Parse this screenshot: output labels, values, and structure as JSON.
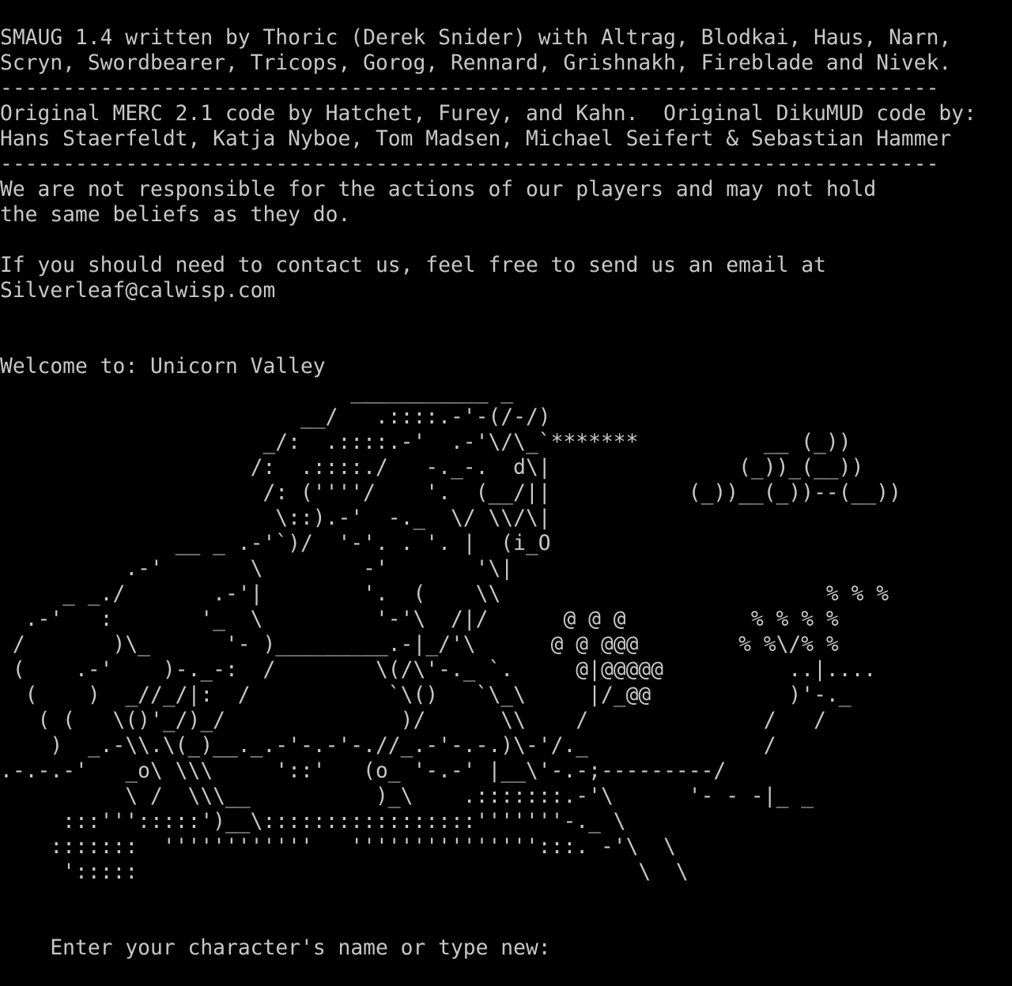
{
  "terminal": {
    "lines": [
      "SMAUG 1.4 written by Thoric (Derek Snider) with Altrag, Blodkai, Haus, Narn,",
      "Scryn, Swordbearer, Tricops, Gorog, Rennard, Grishnakh, Fireblade and Nivek.",
      "---------------------------------------------------------------------------",
      "Original MERC 2.1 code by Hatchet, Furey, and Kahn.  Original DikuMUD code by:",
      "Hans Staerfeldt, Katja Nyboe, Tom Madsen, Michael Seifert & Sebastian Hammer",
      "---------------------------------------------------------------------------",
      "We are not responsible for the actions of our players and may not hold",
      "the same beliefs as they do.",
      "",
      "If you should need to contact us, feel free to send us an email at",
      "Silverleaf@calwisp.com",
      "",
      "",
      "Welcome to: Unicorn Valley",
      "                            ___________ _",
      "                        __/   .::::.-'-(/-/)",
      "                     _/:  .::::.-'  .-'\\/\\_`*******          __ (_))",
      "                    /:  .::::./   -._-.  d\\|               (_))_(__))",
      "                     /: (''''/    '.  (__/||           (_))__(_))--(__))",
      "                      \\::).-'  -._  \\/ \\\\/\\|",
      "              __ _ .-'`)/  '-'. . '. |  (i_O",
      "          .-'       \\        -'       '\\|",
      "     _ _./       .-'|        '.  (    \\\\                          % % %",
      "  .-'   :       '_  \\         '-'\\  /|/      @ @ @          % % % %",
      " /       )\\_      '- )_________.-|_/'\\      @ @ @@@        % %\\/% %",
      " (    .-'    )-._-:  /        \\(/\\'-._ `.     @|@@@@@          ..|....",
      "  (    )  _//_/|:  /           `\\()   `\\_\\     |/_@@           )'-._",
      "   ( (   \\()'_/)_/              )/      \\\\    /              /   /",
      "    )  _.-\\\\.\\(_)__._.-'-.-'-.//_.-'-.-.)\\-'/._              /",
      ".-.-.-'   _o\\ \\\\\\     '::'   (o_ '-.-' |__\\'-.-;---------/",
      "          \\ /  \\\\\\__          )_\\    .:::::::.-'\\      '- - -|_ _",
      "     :::''':::::')__\\:::::::::::::::::'''''''-._ \\",
      "    :::::::  ''''''''''''   ''''''''''''''':::. -'\\  \\",
      "     ':::::                                        \\  \\",
      ""
    ],
    "prompt": "Enter your character's name or type new: "
  }
}
